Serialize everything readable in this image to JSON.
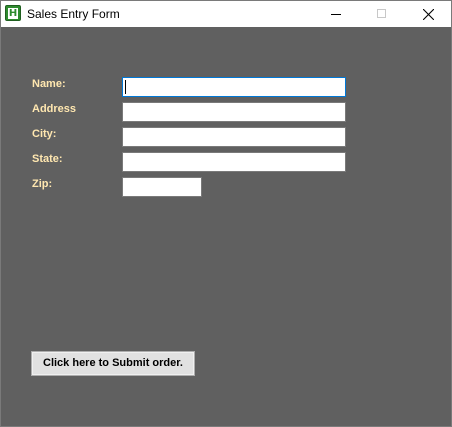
{
  "window": {
    "title": "Sales Entry Form",
    "app_icon_letter": "H",
    "app_icon_color": "#2e8b2e",
    "background_color": "#606060"
  },
  "form": {
    "labels": {
      "name": "Name:",
      "address": "Address",
      "city": "City:",
      "state": "State:",
      "zip": "Zip:"
    },
    "values": {
      "name": "",
      "address": "",
      "city": "",
      "state": "",
      "zip": ""
    },
    "label_color": "#ffe7b0",
    "focused_field": "name"
  },
  "submit": {
    "label": "Click here to Submit order."
  }
}
